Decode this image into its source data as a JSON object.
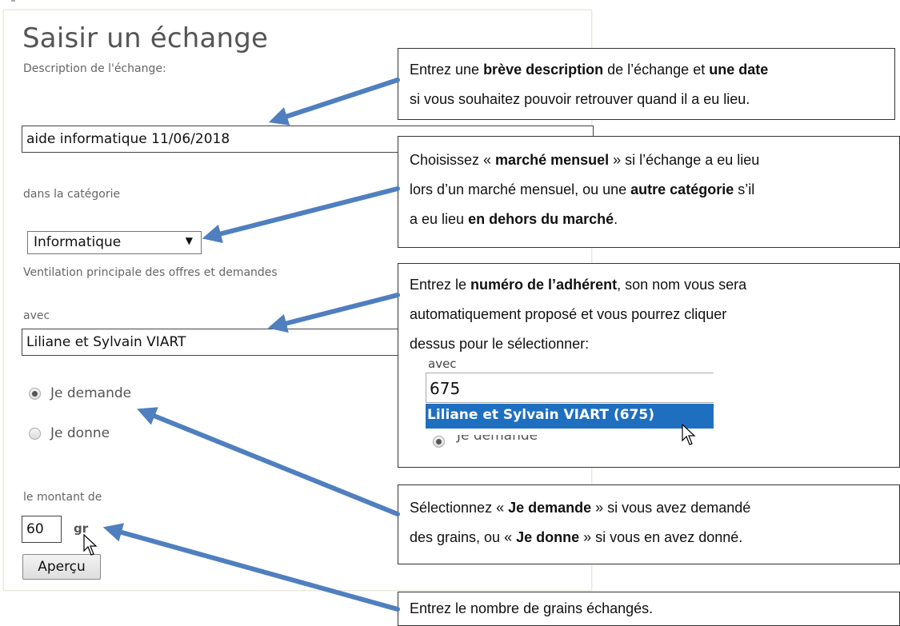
{
  "page": {
    "title": "Saisir un échange",
    "description_label": "Description de l'échange:",
    "description_value": "aide informatique 11/06/2018",
    "category_label": "dans la catégorie",
    "category_value": "Informatique",
    "category_hint": "Ventilation principale des offres et demandes",
    "with_label": "avec",
    "with_value": "Liliane et Sylvain VIART",
    "radio_ask_label": "Je demande",
    "radio_give_label": "Je donne",
    "radio_selected": "Je demande",
    "amount_label": "le montant de",
    "amount_value": "60",
    "amount_unit": "gr",
    "preview_button": "Aperçu"
  },
  "callouts": {
    "c1": {
      "line1": [
        "Entrez une ",
        "brève description",
        " de l’échange et ",
        "une date"
      ],
      "line2": "si vous souhaitez pouvoir retrouver quand il a eu lieu."
    },
    "c2": {
      "line1": [
        "Choisissez « ",
        "marché mensuel",
        " » si l’échange a eu lieu"
      ],
      "line2": [
        "lors d’un marché mensuel, ou une ",
        "autre catégorie",
        " s’il"
      ],
      "line3": [
        "a eu lieu ",
        "en dehors du marché",
        "."
      ]
    },
    "c3": {
      "line1": [
        "Entrez le ",
        "numéro de l’adhérent",
        ", son nom vous sera"
      ],
      "line2": "automatiquement proposé et vous pourrez cliquer",
      "line3": "dessus pour le sélectionner:",
      "inset_label": "avec",
      "inset_value": "675",
      "inset_suggestion": "Liliane et Sylvain VIART (675)",
      "inset_ghost": "Je demande"
    },
    "c4": {
      "line1": [
        "Sélectionnez « ",
        "Je demande",
        " » si vous avez demandé"
      ],
      "line2": [
        "des grains, ou « ",
        "Je donne",
        " »  si vous  en avez donné."
      ]
    },
    "c5": {
      "line1": "Entrez le nombre de grains échangés."
    }
  },
  "colors": {
    "arrow": "#4f7fbf",
    "suggestion_bg": "#1f6fc1"
  },
  "icons": [
    "dropdown-arrow-icon",
    "radio-icon",
    "mouse-cursor-icon",
    "callout-arrow-icon"
  ]
}
